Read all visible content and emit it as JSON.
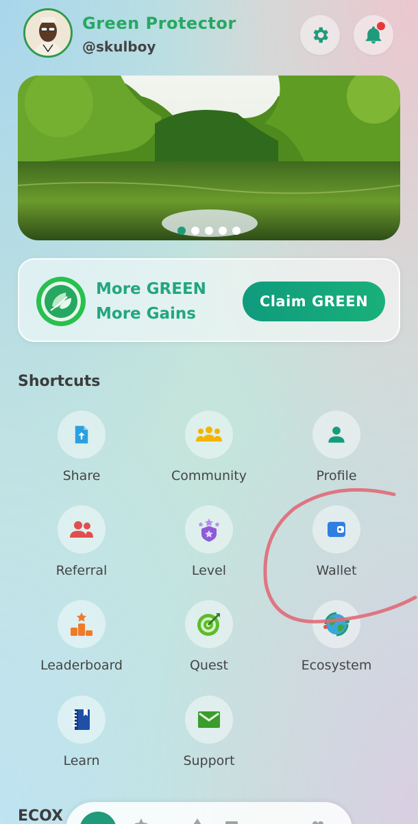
{
  "header": {
    "user_name": "Green Protector",
    "user_handle": "@skulboy",
    "settings_icon": "gear-icon",
    "notification_icon": "bell-icon"
  },
  "banner": {
    "slide_count": 5,
    "active_slide": 1
  },
  "claim_card": {
    "promo_line_1": "More GREEN",
    "promo_line_2": "More Gains",
    "claim_button_label": "Claim GREEN"
  },
  "shortcuts": {
    "title": "Shortcuts",
    "items": [
      {
        "label": "Share",
        "icon": "share-file-icon",
        "color": "#2aa0e0"
      },
      {
        "label": "Community",
        "icon": "community-icon",
        "color": "#f4b400"
      },
      {
        "label": "Profile",
        "icon": "profile-icon",
        "color": "#169b7d"
      },
      {
        "label": "Referral",
        "icon": "referral-icon",
        "color": "#e04e4e"
      },
      {
        "label": "Level",
        "icon": "level-shield-icon",
        "color": "#8e5bd6"
      },
      {
        "label": "Wallet",
        "icon": "wallet-icon",
        "color": "#2f7fe0"
      },
      {
        "label": "Leaderboard",
        "icon": "leaderboard-icon",
        "color": "#f07a2a"
      },
      {
        "label": "Quest",
        "icon": "quest-target-icon",
        "color": "#5dbb2e"
      },
      {
        "label": "Ecosystem",
        "icon": "ecosystem-globe-icon",
        "color": "#1f9a7a"
      },
      {
        "label": "Learn",
        "icon": "learn-book-icon",
        "color": "#1f4fa6"
      },
      {
        "label": "Support",
        "icon": "support-mail-icon",
        "color": "#3a9c2a"
      }
    ]
  },
  "ecox_section": {
    "title": "ECOX"
  },
  "colors": {
    "brand_green": "#27a861",
    "accent_teal": "#1f9a7a",
    "annotation_red": "#e06a78"
  }
}
